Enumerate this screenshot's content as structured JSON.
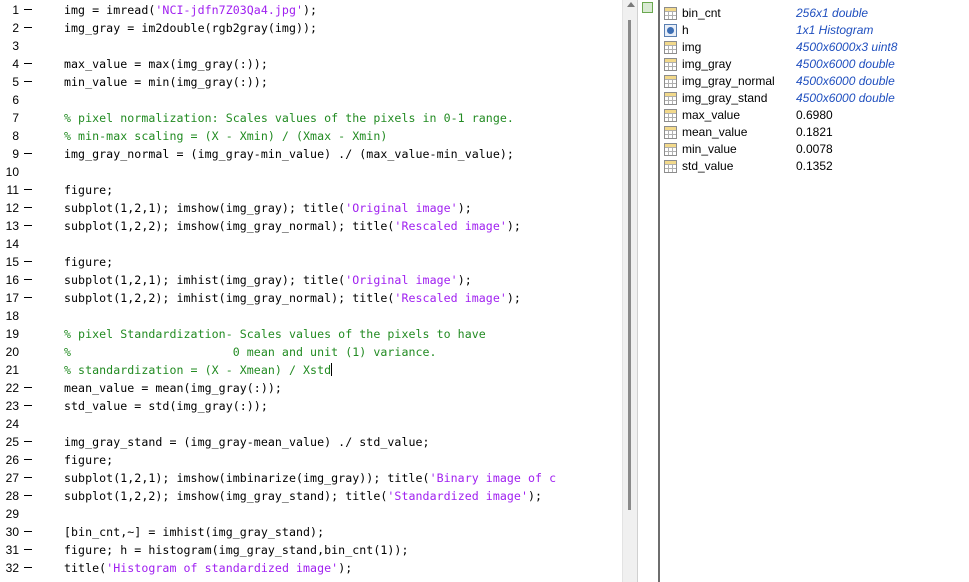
{
  "editor": {
    "lines": [
      {
        "n": "1",
        "fold": true,
        "tokens": [
          {
            "t": "img = imread(",
            "k": "p"
          },
          {
            "t": "'NCI-jdfn7Z03Qa4.jpg'",
            "k": "s"
          },
          {
            "t": ");",
            "k": "p"
          }
        ]
      },
      {
        "n": "2",
        "fold": true,
        "tokens": [
          {
            "t": "img_gray = im2double(rgb2gray(img));",
            "k": "p"
          }
        ]
      },
      {
        "n": "3",
        "fold": false,
        "tokens": []
      },
      {
        "n": "4",
        "fold": true,
        "tokens": [
          {
            "t": "max_value = max(img_gray(:));",
            "k": "p"
          }
        ]
      },
      {
        "n": "5",
        "fold": true,
        "tokens": [
          {
            "t": "min_value = min(img_gray(:));",
            "k": "p"
          }
        ]
      },
      {
        "n": "6",
        "fold": false,
        "tokens": []
      },
      {
        "n": "7",
        "fold": false,
        "tokens": [
          {
            "t": "% pixel normalization: Scales values of the pixels in 0-1 range.",
            "k": "c"
          }
        ]
      },
      {
        "n": "8",
        "fold": false,
        "tokens": [
          {
            "t": "% min-max scaling = (X - Xmin) / (Xmax - Xmin)",
            "k": "c"
          }
        ]
      },
      {
        "n": "9",
        "fold": true,
        "tokens": [
          {
            "t": "img_gray_normal = (img_gray-min_value) ./ (max_value-min_value);",
            "k": "p"
          }
        ]
      },
      {
        "n": "10",
        "fold": false,
        "tokens": []
      },
      {
        "n": "11",
        "fold": true,
        "tokens": [
          {
            "t": "figure;",
            "k": "p"
          }
        ]
      },
      {
        "n": "12",
        "fold": true,
        "tokens": [
          {
            "t": "subplot(1,2,1); imshow(img_gray); title(",
            "k": "p"
          },
          {
            "t": "'Original image'",
            "k": "s"
          },
          {
            "t": ");",
            "k": "p"
          }
        ]
      },
      {
        "n": "13",
        "fold": true,
        "tokens": [
          {
            "t": "subplot(1,2,2); imshow(img_gray_normal); title(",
            "k": "p"
          },
          {
            "t": "'Rescaled image'",
            "k": "s"
          },
          {
            "t": ");",
            "k": "p"
          }
        ]
      },
      {
        "n": "14",
        "fold": false,
        "tokens": []
      },
      {
        "n": "15",
        "fold": true,
        "tokens": [
          {
            "t": "figure;",
            "k": "p"
          }
        ]
      },
      {
        "n": "16",
        "fold": true,
        "tokens": [
          {
            "t": "subplot(1,2,1); imhist(img_gray); title(",
            "k": "p"
          },
          {
            "t": "'Original image'",
            "k": "s"
          },
          {
            "t": ");",
            "k": "p"
          }
        ]
      },
      {
        "n": "17",
        "fold": true,
        "tokens": [
          {
            "t": "subplot(1,2,2); imhist(img_gray_normal); title(",
            "k": "p"
          },
          {
            "t": "'Rescaled image'",
            "k": "s"
          },
          {
            "t": ");",
            "k": "p"
          }
        ]
      },
      {
        "n": "18",
        "fold": false,
        "tokens": []
      },
      {
        "n": "19",
        "fold": false,
        "tokens": [
          {
            "t": "% pixel Standardization- Scales values of the pixels to have",
            "k": "c"
          }
        ]
      },
      {
        "n": "20",
        "fold": false,
        "tokens": [
          {
            "t": "%                       0 mean and unit (1) variance.",
            "k": "c"
          }
        ]
      },
      {
        "n": "21",
        "fold": false,
        "caret": true,
        "tokens": [
          {
            "t": "% standardization = (X - Xmean) / Xstd",
            "k": "c"
          }
        ]
      },
      {
        "n": "22",
        "fold": true,
        "tokens": [
          {
            "t": "mean_value = mean(img_gray(:));",
            "k": "p"
          }
        ]
      },
      {
        "n": "23",
        "fold": true,
        "tokens": [
          {
            "t": "std_value = std(img_gray(:));",
            "k": "p"
          }
        ]
      },
      {
        "n": "24",
        "fold": false,
        "tokens": []
      },
      {
        "n": "25",
        "fold": true,
        "tokens": [
          {
            "t": "img_gray_stand = (img_gray-mean_value) ./ std_value;",
            "k": "p"
          }
        ]
      },
      {
        "n": "26",
        "fold": true,
        "tokens": [
          {
            "t": "figure;",
            "k": "p"
          }
        ]
      },
      {
        "n": "27",
        "fold": true,
        "tokens": [
          {
            "t": "subplot(1,2,1); imshow(imbinarize(img_gray)); title(",
            "k": "p"
          },
          {
            "t": "'Binary image of c",
            "k": "s"
          }
        ]
      },
      {
        "n": "28",
        "fold": true,
        "tokens": [
          {
            "t": "subplot(1,2,2); imshow(img_gray_stand); title(",
            "k": "p"
          },
          {
            "t": "'Standardized image'",
            "k": "s"
          },
          {
            "t": ");",
            "k": "p"
          }
        ]
      },
      {
        "n": "29",
        "fold": false,
        "tokens": []
      },
      {
        "n": "30",
        "fold": true,
        "tokens": [
          {
            "t": "[bin_cnt,~] = imhist(img_gray_stand);",
            "k": "p"
          }
        ]
      },
      {
        "n": "31",
        "fold": true,
        "tokens": [
          {
            "t": "figure; h = histogram(img_gray_stand,bin_cnt(1));",
            "k": "p"
          }
        ]
      },
      {
        "n": "32",
        "fold": true,
        "tokens": [
          {
            "t": "title(",
            "k": "p"
          },
          {
            "t": "'Histogram of standardized image'",
            "k": "s"
          },
          {
            "t": ");",
            "k": "p"
          }
        ]
      }
    ]
  },
  "workspace": {
    "variables": [
      {
        "name": "bin_cnt",
        "value": "256x1 double",
        "icon": "grid-icon",
        "info": true
      },
      {
        "name": "h",
        "value": "1x1 Histogram",
        "icon": "object-icon",
        "info": true
      },
      {
        "name": "img",
        "value": "4500x6000x3 uint8",
        "icon": "grid-icon",
        "info": true
      },
      {
        "name": "img_gray",
        "value": "4500x6000 double",
        "icon": "grid-icon",
        "info": true
      },
      {
        "name": "img_gray_normal",
        "value": "4500x6000 double",
        "icon": "grid-icon",
        "info": true
      },
      {
        "name": "img_gray_stand",
        "value": "4500x6000 double",
        "icon": "grid-icon",
        "info": true
      },
      {
        "name": "max_value",
        "value": "0.6980",
        "icon": "grid-icon",
        "info": false
      },
      {
        "name": "mean_value",
        "value": "0.1821",
        "icon": "grid-icon",
        "info": false
      },
      {
        "name": "min_value",
        "value": "0.0078",
        "icon": "grid-icon",
        "info": false
      },
      {
        "name": "std_value",
        "value": "0.1352",
        "icon": "grid-icon",
        "info": false
      }
    ]
  },
  "colors": {
    "string": "#a020f0",
    "comment": "#228b22",
    "info_value": "#1f4fbf"
  }
}
